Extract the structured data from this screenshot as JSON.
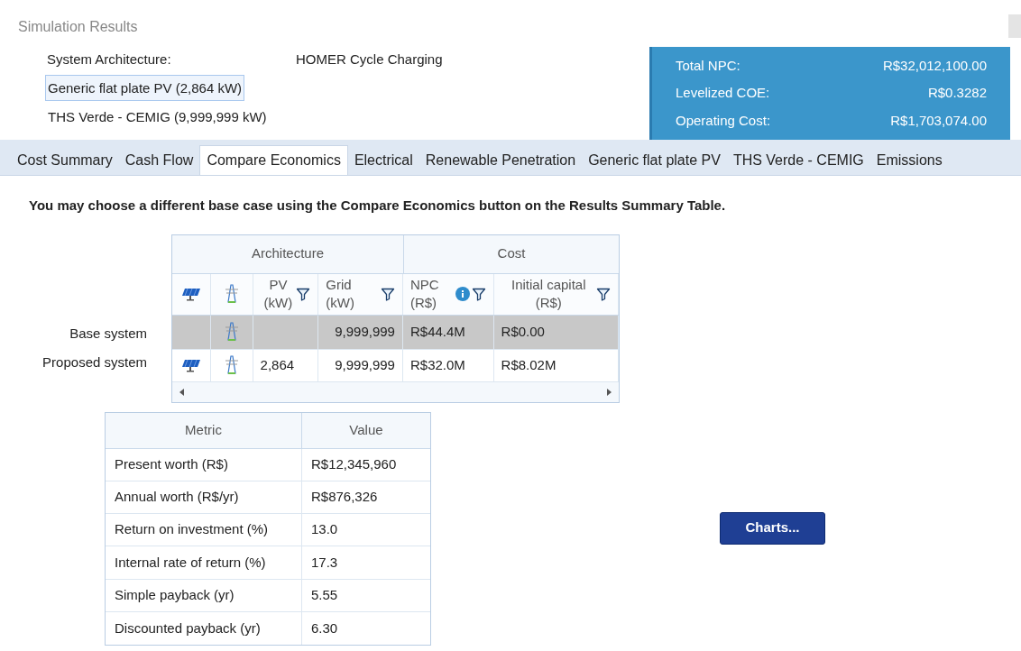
{
  "window": {
    "title": "Simulation Results"
  },
  "architecture": {
    "label": "System Architecture:",
    "strategy": "HOMER Cycle Charging",
    "components": [
      {
        "text": "Generic flat plate PV (2,864 kW)",
        "selected": true
      },
      {
        "text": "THS Verde - CEMIG (9,999,999 kW)",
        "selected": false
      }
    ]
  },
  "summary": [
    {
      "label": "Total NPC:",
      "value": "R$32,012,100.00"
    },
    {
      "label": "Levelized COE:",
      "value": "R$0.3282"
    },
    {
      "label": "Operating Cost:",
      "value": "R$1,703,074.00"
    }
  ],
  "tabs": [
    {
      "label": "Cost Summary",
      "selected": false
    },
    {
      "label": "Cash Flow",
      "selected": false
    },
    {
      "label": "Compare Economics",
      "selected": true
    },
    {
      "label": "Electrical",
      "selected": false
    },
    {
      "label": "Renewable Penetration",
      "selected": false
    },
    {
      "label": "Generic flat plate PV",
      "selected": false
    },
    {
      "label": "THS Verde - CEMIG",
      "selected": false
    },
    {
      "label": "Emissions",
      "selected": false
    }
  ],
  "note": "You may choose a different base case using the Compare Economics button on the Results Summary Table.",
  "comparison": {
    "groups": [
      "Architecture",
      "Cost"
    ],
    "columns": [
      "PV (kW)",
      "Grid (kW)",
      "NPC (R$)",
      "Initial capital (R$)"
    ],
    "rows": [
      {
        "label": "Base system",
        "pv": false,
        "grid": true,
        "selected": true,
        "cells": [
          "",
          "9,999,999",
          "R$44.4M",
          "R$0.00"
        ]
      },
      {
        "label": "Proposed system",
        "pv": true,
        "grid": true,
        "selected": false,
        "cells": [
          "2,864",
          "9,999,999",
          "R$32.0M",
          "R$8.02M"
        ]
      }
    ]
  },
  "metrics": {
    "columns": [
      "Metric",
      "Value"
    ],
    "rows": [
      [
        "Present worth (R$)",
        "R$12,345,960"
      ],
      [
        "Annual worth (R$/yr)",
        "R$876,326"
      ],
      [
        "Return on investment (%)",
        "13.0"
      ],
      [
        "Internal rate of return (%)",
        "17.3"
      ],
      [
        "Simple payback (yr)",
        "5.55"
      ],
      [
        "Discounted payback (yr)",
        "6.30"
      ]
    ]
  },
  "charts_button": "Charts..."
}
